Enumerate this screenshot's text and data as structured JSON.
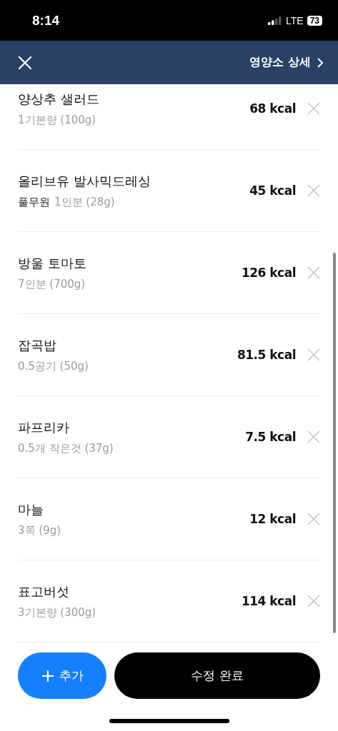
{
  "status_bar": {
    "time": "8:14",
    "network": "LTE",
    "battery": "73"
  },
  "header": {
    "link": "영양소 상세"
  },
  "items": [
    {
      "name": "양상추 샐러드",
      "serving": "1기본량 (100g)",
      "kcal": "68 kcal"
    },
    {
      "name": "올리브유 발사믹드레싱",
      "brand": "풀무원",
      "serving": "1인분 (28g)",
      "kcal": "45 kcal"
    },
    {
      "name": "방울 토마토",
      "serving": "7인분 (700g)",
      "kcal": "126 kcal"
    },
    {
      "name": "잡곡밥",
      "serving": "0.5공기 (50g)",
      "kcal": "81.5 kcal"
    },
    {
      "name": "파프리카",
      "serving": "0.5개 작은것 (37g)",
      "kcal": "7.5 kcal"
    },
    {
      "name": "마늘",
      "serving": "3쪽 (9g)",
      "kcal": "12 kcal"
    },
    {
      "name": "표고버섯",
      "serving": "3기본량 (300g)",
      "kcal": "114 kcal"
    }
  ],
  "buttons": {
    "add": "추가",
    "done": "수정 완료"
  }
}
